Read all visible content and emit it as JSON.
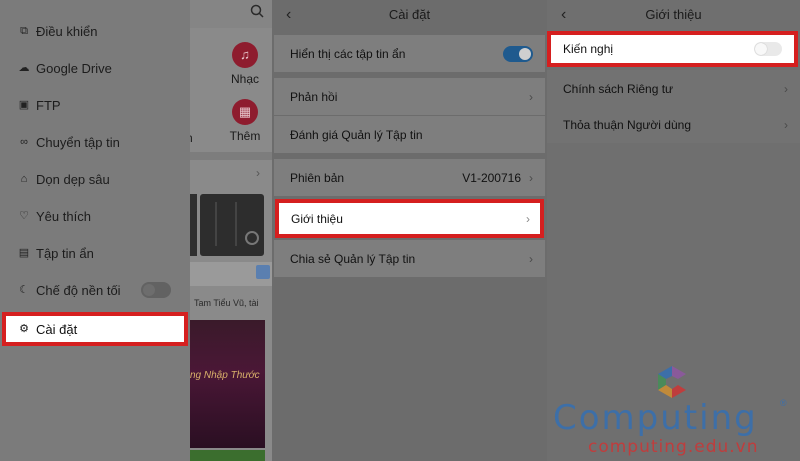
{
  "panel1": {
    "drawer_items": [
      {
        "label": "Điều khiển",
        "icon": "remote-icon"
      },
      {
        "label": "Google Drive",
        "icon": "drive-icon"
      },
      {
        "label": "FTP",
        "icon": "ftp-icon"
      },
      {
        "label": "Chuyển tập tin",
        "icon": "transfer-icon"
      },
      {
        "label": "Dọn dẹp sâu",
        "icon": "clean-icon"
      },
      {
        "label": "Yêu thích",
        "icon": "heart-icon"
      },
      {
        "label": "Tập tin ẩn",
        "icon": "hidden-file-icon"
      },
      {
        "label": "Chế độ nền tối",
        "icon": "moon-icon"
      }
    ],
    "settings_item": {
      "label": "Cài đặt",
      "icon": "gear-icon"
    },
    "dark_mode_enabled": false,
    "home": {
      "music_label": "Nhạc",
      "more_label": "Thêm",
      "partial_label": "n",
      "ad_text": "Tam Tiểu Vũ, tài",
      "video_text": "ng Nhập Thước"
    }
  },
  "panel2": {
    "title": "Cài đặt",
    "rows": {
      "show_hidden": "Hiển thị các tập tin ẩn",
      "feedback": "Phản hồi",
      "rate": "Đánh giá Quản lý Tập tin",
      "version": "Phiên bản",
      "version_value": "V1-200716",
      "about": "Giới thiệu",
      "share": "Chia sẻ Quản lý Tập tin"
    },
    "show_hidden_enabled": true
  },
  "panel3": {
    "title": "Giới thiệu",
    "rows": {
      "recommend": "Kiến nghị",
      "privacy": "Chính sách Riêng tư",
      "terms": "Thỏa thuận Người dùng"
    },
    "recommend_enabled": false
  },
  "watermark": {
    "name": "Computing",
    "reg": "®",
    "url": "computing.edu.vn"
  },
  "colors": {
    "highlight_border": "#d51f1f",
    "toggle_on": "#1f5a8e",
    "watermark_blue": "#3d6fa8",
    "watermark_red": "#bf3d3d"
  }
}
